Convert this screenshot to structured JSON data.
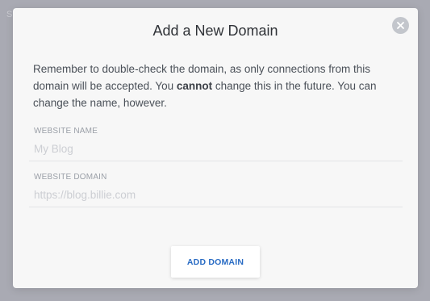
{
  "backdrop": {
    "text": "S"
  },
  "modal": {
    "title": "Add a New Domain",
    "description_before": "Remember to double-check the domain, as only connections from this domain will be accepted. You ",
    "description_bold": "cannot",
    "description_after": " change this in the future. You can change the name, however.",
    "close_icon": "close-icon",
    "fields": {
      "name": {
        "label": "WEBSITE NAME",
        "placeholder": "My Blog",
        "value": ""
      },
      "domain": {
        "label": "WEBSITE DOMAIN",
        "placeholder": "https://blog.billie.com",
        "value": ""
      }
    },
    "submit_label": "ADD DOMAIN"
  },
  "colors": {
    "backdrop": "#a9aab3",
    "modal_bg": "#f7f7f7",
    "accent": "#2a6cc4",
    "close_bg": "#c3c6cc"
  }
}
